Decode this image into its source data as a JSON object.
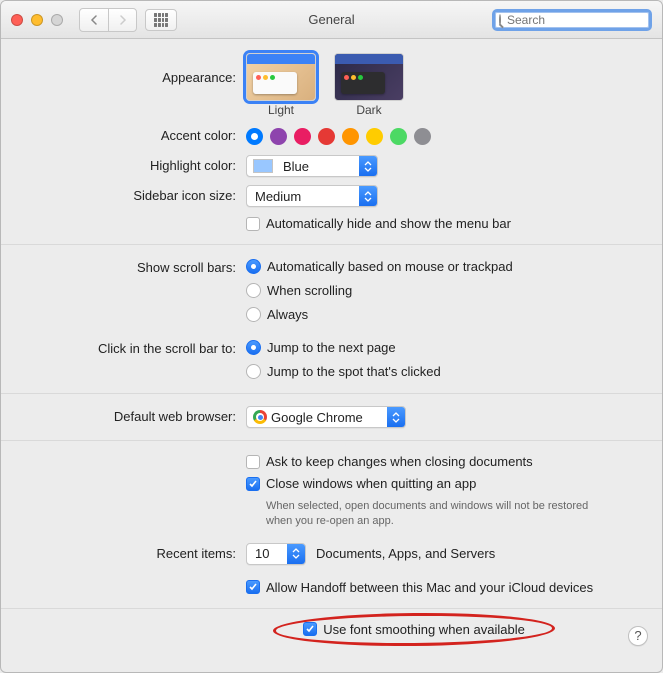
{
  "window": {
    "title": "General"
  },
  "search": {
    "placeholder": "Search"
  },
  "labels": {
    "appearance": "Appearance:",
    "accent": "Accent color:",
    "highlight": "Highlight color:",
    "sidebar": "Sidebar icon size:",
    "scrollbars": "Show scroll bars:",
    "clickscroll": "Click in the scroll bar to:",
    "browser": "Default web browser:",
    "recent": "Recent items:"
  },
  "appearance": {
    "options": [
      "Light",
      "Dark"
    ],
    "selected": "Light"
  },
  "accent": {
    "colors": [
      "blue",
      "purple",
      "pink",
      "red",
      "orange",
      "yellow",
      "green",
      "grey"
    ],
    "selected": "blue"
  },
  "highlight": {
    "value": "Blue",
    "swatch": "#99c7ff"
  },
  "sidebar": {
    "value": "Medium"
  },
  "autohide": {
    "label": "Automatically hide and show the menu bar",
    "checked": false
  },
  "scrollbars": {
    "options": [
      "Automatically based on mouse or trackpad",
      "When scrolling",
      "Always"
    ],
    "selected": 0
  },
  "clickscroll": {
    "options": [
      "Jump to the next page",
      "Jump to the spot that's clicked"
    ],
    "selected": 0
  },
  "browser": {
    "value": "Google Chrome"
  },
  "askkeep": {
    "label": "Ask to keep changes when closing documents",
    "checked": false
  },
  "closewin": {
    "label": "Close windows when quitting an app",
    "checked": true,
    "help": "When selected, open documents and windows will not be restored when you re-open an app."
  },
  "recent": {
    "value": "10",
    "suffix": "Documents, Apps, and Servers"
  },
  "handoff": {
    "label": "Allow Handoff between this Mac and your iCloud devices",
    "checked": true
  },
  "fontsmoothing": {
    "label": "Use font smoothing when available",
    "checked": true
  },
  "help_glyph": "?"
}
